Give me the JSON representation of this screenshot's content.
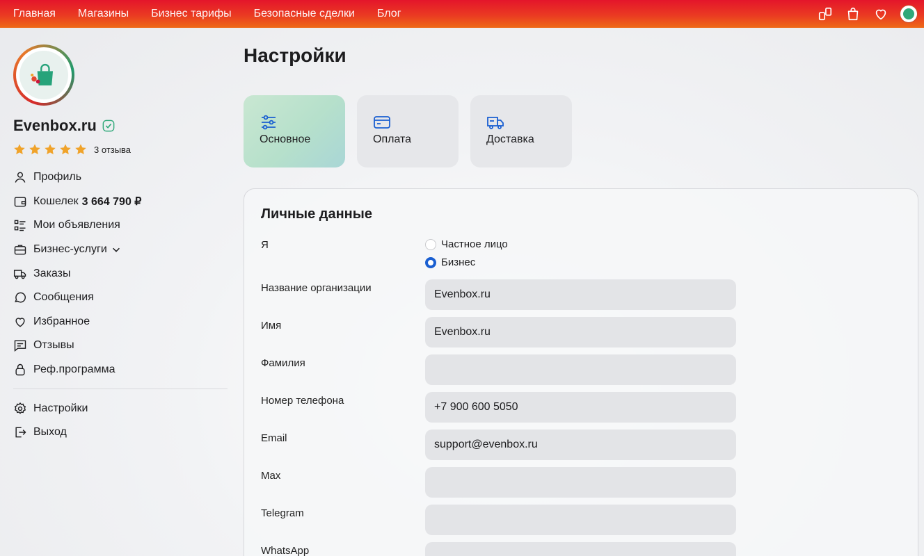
{
  "topnav": {
    "links": [
      "Главная",
      "Магазины",
      "Бизнес тарифы",
      "Безопасные сделки",
      "Блог"
    ],
    "icons": [
      "compare-icon",
      "bag-icon",
      "heart-icon",
      "avatar"
    ]
  },
  "colors": {
    "topbar_start": "#e4152b",
    "topbar_end": "#ee6a17",
    "active_tab": "#b6e0cb",
    "accent_blue": "#1a5fd1",
    "star": "#f0a32a",
    "verified": "#2fa879"
  },
  "shop": {
    "name": "Evenbox.ru",
    "rating_stars": 5,
    "reviews": "3 отзыва"
  },
  "sidebar": {
    "items": [
      {
        "label": "Профиль",
        "icon": "user-icon"
      },
      {
        "label": "Кошелек",
        "value": "3 664 790 ₽",
        "icon": "wallet-icon"
      },
      {
        "label": "Мои объявления",
        "icon": "list-icon"
      },
      {
        "label": "Бизнес-услуги",
        "icon": "briefcase-icon"
      },
      {
        "label": "Заказы",
        "icon": "truck-icon"
      },
      {
        "label": "Сообщения",
        "icon": "chat-icon"
      },
      {
        "label": "Избранное",
        "icon": "heart-icon"
      },
      {
        "label": "Отзывы",
        "icon": "review-icon"
      },
      {
        "label": "Реф.программа",
        "icon": "referral-icon"
      }
    ],
    "bottom": [
      {
        "label": "Настройки",
        "icon": "gear-icon"
      },
      {
        "label": "Выход",
        "icon": "logout-icon"
      }
    ]
  },
  "main": {
    "title": "Настройки",
    "tabs": [
      {
        "label": "Основное",
        "icon": "sliders-icon",
        "active": true
      },
      {
        "label": "Оплата",
        "icon": "card-icon",
        "active": false
      },
      {
        "label": "Доставка",
        "icon": "truck-icon",
        "active": false
      }
    ],
    "section_title": "Личные данные",
    "account_type": {
      "label": "Я",
      "options": [
        "Частное лицо",
        "Бизнес"
      ],
      "selected": "Бизнес"
    },
    "fields": [
      {
        "label": "Название организации",
        "value": "Evenbox.ru"
      },
      {
        "label": "Имя",
        "value": "Evenbox.ru"
      },
      {
        "label": "Фамилия",
        "value": ""
      },
      {
        "label": "Номер телефона",
        "value": "+7 900 600 5050"
      },
      {
        "label": "Email",
        "value": "support@evenbox.ru"
      },
      {
        "label": "Max",
        "value": ""
      },
      {
        "label": "Telegram",
        "value": ""
      },
      {
        "label": "WhatsApp",
        "value": ""
      }
    ]
  }
}
